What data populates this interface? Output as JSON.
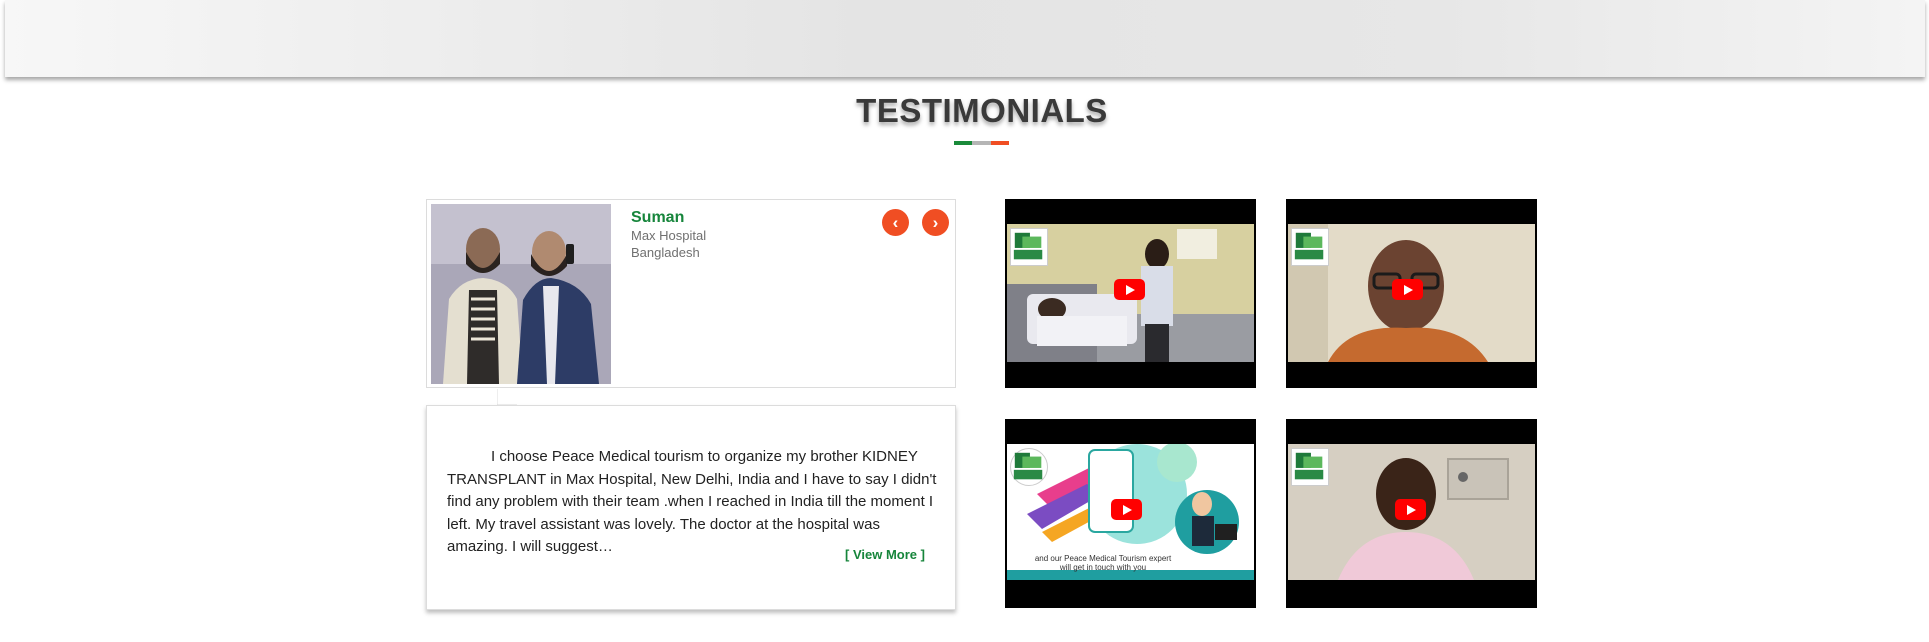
{
  "section": {
    "title": "TESTIMONIALS",
    "divider_colors": [
      "#1a8a3a",
      "#b5b5b5",
      "#f04e23"
    ]
  },
  "testimonial": {
    "name": "Suman",
    "hospital": "Max Hospital",
    "country": "Bangladesh",
    "prev_icon": "chevron-left-icon",
    "next_icon": "chevron-right-icon",
    "prev_glyph": "‹",
    "next_glyph": "›",
    "quote": "I choose Peace Medical tourism to organize my brother KIDNEY TRANSPLANT in Max Hospital, New Delhi, India and I have to say I didn't find any problem with their team .when I reached in India till the moment I left. My travel assistant was lovely. The doctor at the hospital was amazing. I will suggest…",
    "view_more_label": "[ View More ]"
  },
  "videos": {
    "thumb3_caption": "and our Peace Medical Tourism expert will get in touch with you",
    "play_icon": "youtube-play-icon"
  },
  "colors": {
    "accent_green": "#16853b",
    "accent_orange": "#f04e23",
    "youtube_red": "#ff0000"
  }
}
